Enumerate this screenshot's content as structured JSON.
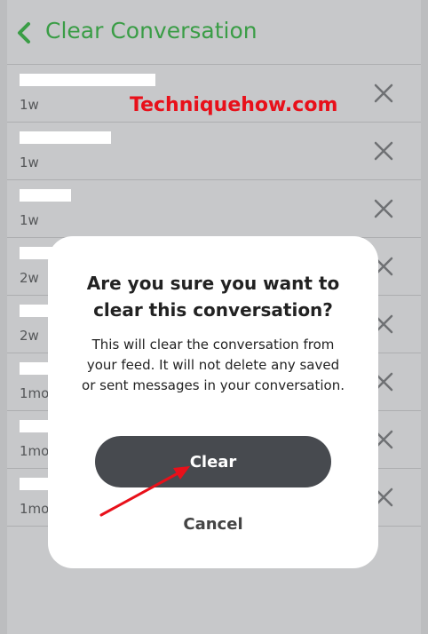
{
  "header": {
    "title": "Clear Conversation",
    "back_icon": "chevron-left-icon",
    "accent_color": "#3a9d46"
  },
  "conversations": [
    {
      "name_visible": false,
      "time": "1w"
    },
    {
      "name_visible": false,
      "time": "1w"
    },
    {
      "name_visible": false,
      "time": "1w"
    },
    {
      "name_visible": false,
      "time": "2w"
    },
    {
      "name_visible": false,
      "time": "2w"
    },
    {
      "name_visible": false,
      "time": "1mo"
    },
    {
      "name_visible": false,
      "time": "1mo"
    },
    {
      "name_visible": false,
      "time": "1mo"
    }
  ],
  "watermark": "Techniquehow.com",
  "dialog": {
    "title": "Are you sure you want to clear this conversation?",
    "body": "This will clear the conversation from your feed. It will not delete any saved or sent messages in your conversation.",
    "clear_label": "Clear",
    "cancel_label": "Cancel"
  }
}
